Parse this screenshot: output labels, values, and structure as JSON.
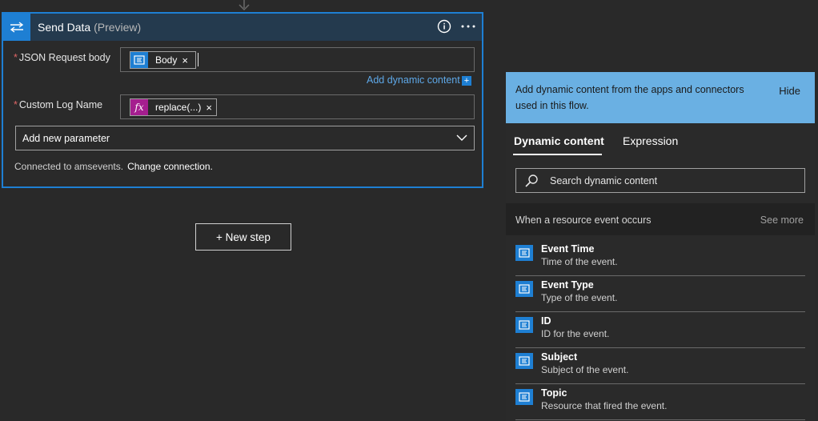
{
  "action": {
    "title": "Send Data",
    "title_suffix": "(Preview)",
    "params": [
      {
        "required_mark": "*",
        "label": "JSON Request body",
        "token_label": "Body",
        "token_close": "×"
      },
      {
        "required_mark": "*",
        "label": "Custom Log Name",
        "token_label": "replace(...)",
        "token_close": "×"
      }
    ],
    "add_dynamic_label": "Add dynamic content",
    "add_dynamic_icon": "+",
    "add_parameter_placeholder": "Add new parameter",
    "connection_text": "Connected to amsevents.",
    "change_connection": "Change connection."
  },
  "new_step_label": "+ New step",
  "panel": {
    "banner_text": "Add dynamic content from the apps and connectors used in this flow.",
    "hide_label": "Hide",
    "tabs": [
      {
        "label": "Dynamic content",
        "active": true
      },
      {
        "label": "Expression",
        "active": false
      }
    ],
    "search_placeholder": "Search dynamic content",
    "section_title": "When a resource event occurs",
    "see_more": "See more",
    "items": [
      {
        "name": "Event Time",
        "desc": "Time of the event."
      },
      {
        "name": "Event Type",
        "desc": "Type of the event."
      },
      {
        "name": "ID",
        "desc": "ID for the event."
      },
      {
        "name": "Subject",
        "desc": "Subject of the event."
      },
      {
        "name": "Topic",
        "desc": "Resource that fired the event."
      }
    ]
  },
  "colors": {
    "accent": "#1e7fd3",
    "banner": "#6ab0e3",
    "expression_token": "#a51e8f",
    "background": "#292929"
  }
}
